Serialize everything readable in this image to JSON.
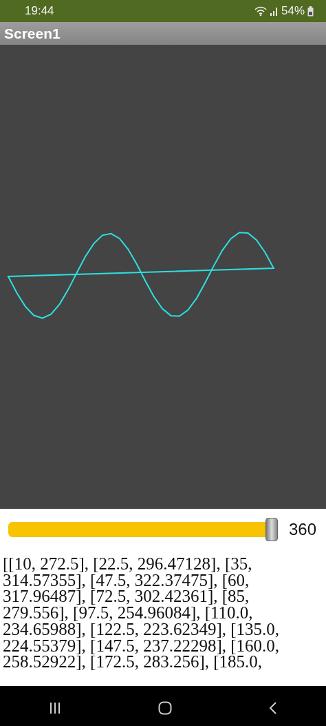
{
  "status_bar": {
    "time": "19:44",
    "battery": "54%"
  },
  "title_bar": {
    "title": "Screen1"
  },
  "slider": {
    "level": 1,
    "reading": "360"
  },
  "output_text": "[[10, 272.5], [22.5, 296.47128], [35, 314.57355], [47.5, 322.37475], [60, 317.96487], [72.5, 302.42361], [85, 279.556], [97.5, 254.96084], [110.0, 234.65988], [122.5, 223.62349], [135.0, 224.55379], [147.5, 237.22298], [160.0, 258.52922], [172.5, 283.256], [185.0,"
}
